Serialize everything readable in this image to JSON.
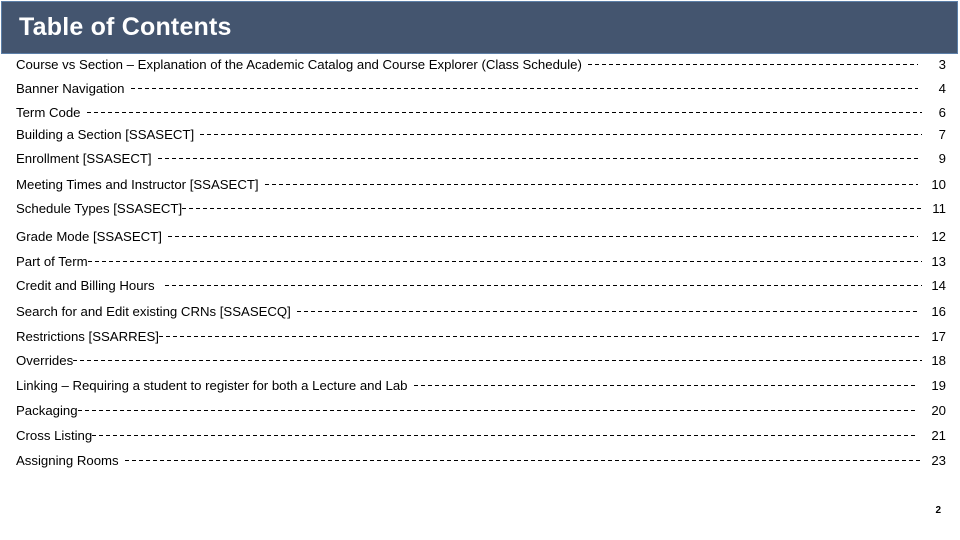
{
  "header": {
    "title": "Table of Contents",
    "background_color": "#44556F",
    "border_color": "#5C7FA8",
    "text_color": "#FFFFFF"
  },
  "toc": {
    "leader_style": "dashed",
    "entries": [
      {
        "label": "Course vs Section – Explanation of the Academic Catalog and Course Explorer (Class Schedule)",
        "page": "3"
      },
      {
        "label": "Banner Navigation",
        "page": "4"
      },
      {
        "label": "Term Code",
        "page": "6"
      },
      {
        "label": "Building a Section [SSASECT]",
        "page": "7"
      },
      {
        "label": "Enrollment [SSASECT]",
        "page": "9"
      },
      {
        "label": "Meeting Times and Instructor [SSASECT]",
        "page": "10"
      },
      {
        "label": "Schedule Types [SSASECT]",
        "page": "11"
      },
      {
        "label": "Grade Mode [SSASECT]",
        "page": "12"
      },
      {
        "label": "Part of Term",
        "page": "13"
      },
      {
        "label": "Credit and Billing Hours",
        "page": "14"
      },
      {
        "label": "Search for and Edit existing CRNs [SSASECQ]",
        "page": "16"
      },
      {
        "label": "Restrictions [SSARRES]",
        "page": "17"
      },
      {
        "label": "Overrides",
        "page": "18"
      },
      {
        "label": "Linking – Requiring a student to register for both a Lecture and Lab",
        "page": "19"
      },
      {
        "label": "Packaging",
        "page": "20"
      },
      {
        "label": "Cross Listing",
        "page": "21"
      },
      {
        "label": "Assigning Rooms",
        "page": "23"
      }
    ]
  },
  "footer": {
    "slide_number": "2"
  }
}
